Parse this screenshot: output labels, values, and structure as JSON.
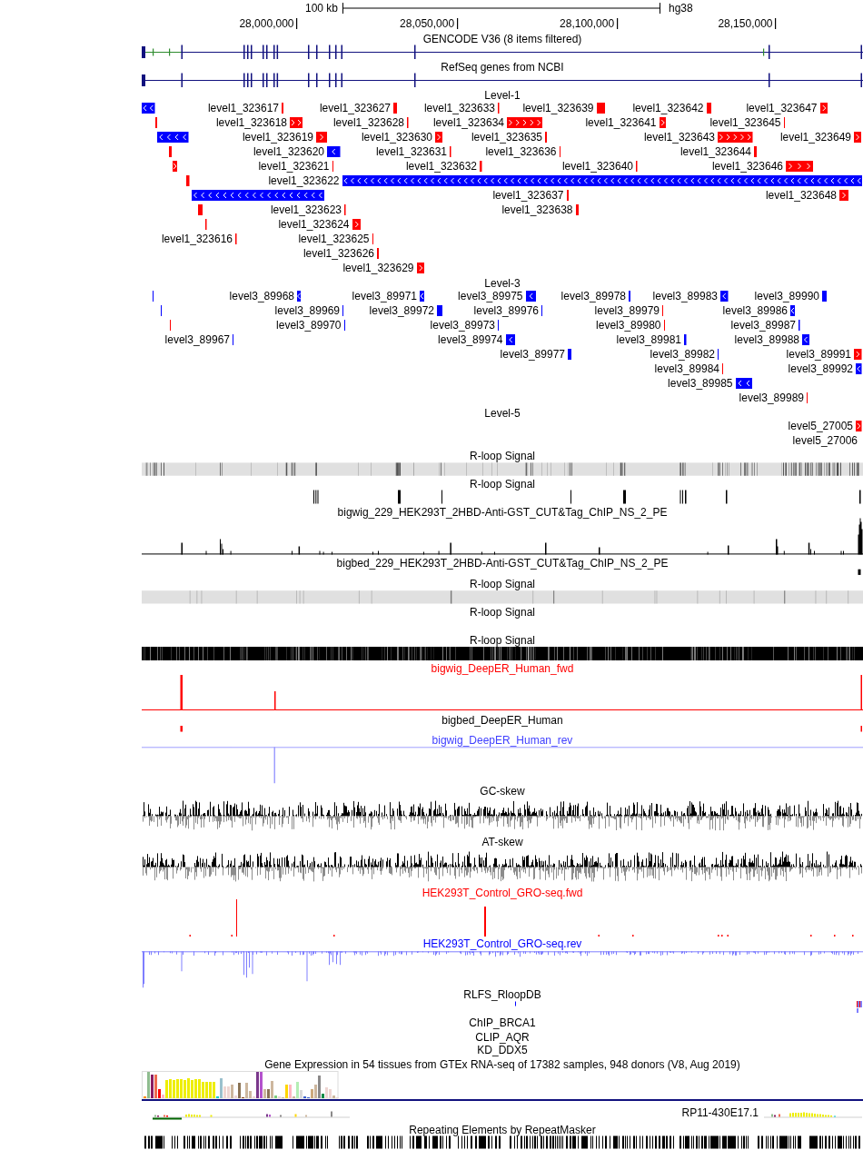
{
  "ruler": {
    "scale_label": "100 kb",
    "assembly": "hg38",
    "ticks": [
      "28,000,000",
      "28,050,000",
      "28,100,000",
      "28,150,000"
    ]
  },
  "tracks": [
    {
      "kind": "gene",
      "title": "GENCODE V36 (8 items filtered)",
      "color": "#000000"
    },
    {
      "kind": "gene",
      "title": "RefSeq genes from NCBI",
      "color": "#000000"
    },
    {
      "kind": "features",
      "title": "Level-1",
      "color": "#000000",
      "items": [
        {
          "kind": "minus"
        },
        {
          "label": "level1_323617",
          "kind": "plus"
        },
        {
          "label": "level1_323627",
          "kind": "plus"
        },
        {
          "label": "level1_323633",
          "kind": "plus"
        },
        {
          "label": "level1_323639",
          "kind": "plus"
        },
        {
          "label": "level1_323642",
          "kind": "plus"
        },
        {
          "label": "level1_323647",
          "kind": "plus"
        },
        {
          "kind": "plus"
        },
        {
          "label": "level1_323618",
          "kind": "plus"
        },
        {
          "label": "level1_323628",
          "kind": "plus"
        },
        {
          "label": "level1_323634",
          "kind": "plus"
        },
        {
          "label": "level1_323641",
          "kind": "plus"
        },
        {
          "label": "level1_323645",
          "kind": "plus"
        },
        {
          "kind": "minus"
        },
        {
          "label": "level1_323619",
          "kind": "plus"
        },
        {
          "label": "level1_323630",
          "kind": "plus"
        },
        {
          "label": "level1_323635",
          "kind": "plus"
        },
        {
          "label": "level1_323643",
          "kind": "plus"
        },
        {
          "label": "level1_323649",
          "kind": "plus"
        },
        {
          "kind": "plus"
        },
        {
          "label": "level1_323620",
          "kind": "minus"
        },
        {
          "label": "level1_323631",
          "kind": "plus"
        },
        {
          "label": "level1_323636",
          "kind": "plus"
        },
        {
          "label": "level1_323644",
          "kind": "plus"
        },
        {
          "kind": "plus"
        },
        {
          "label": "level1_323621",
          "kind": "plus"
        },
        {
          "label": "level1_323632",
          "kind": "plus"
        },
        {
          "label": "level1_323640",
          "kind": "plus"
        },
        {
          "label": "level1_323646",
          "kind": "plus"
        },
        {
          "kind": "plus"
        },
        {
          "label": "level1_323622",
          "kind": "minus"
        },
        {
          "kind": "minus"
        },
        {
          "label": "level1_323637",
          "kind": "plus"
        },
        {
          "label": "level1_323648",
          "kind": "plus"
        },
        {
          "kind": "plus"
        },
        {
          "label": "level1_323623",
          "kind": "plus"
        },
        {
          "label": "level1_323638",
          "kind": "plus"
        },
        {
          "kind": "plus"
        },
        {
          "label": "level1_323624",
          "kind": "plus"
        },
        {
          "label": "level1_323616",
          "kind": "plus"
        },
        {
          "label": "level1_323625",
          "kind": "plus"
        },
        {
          "label": "level1_323626",
          "kind": "plus"
        },
        {
          "label": "level1_323629",
          "kind": "plus"
        }
      ]
    },
    {
      "kind": "features",
      "title": "Level-3",
      "color": "#000000",
      "items": [
        {
          "kind": "minus"
        },
        {
          "label": "level3_89968",
          "kind": "minus"
        },
        {
          "label": "level3_89971",
          "kind": "minus"
        },
        {
          "label": "level3_89975",
          "kind": "minus"
        },
        {
          "label": "level3_89978",
          "kind": "minus"
        },
        {
          "label": "level3_89983",
          "kind": "minus"
        },
        {
          "label": "level3_89990",
          "kind": "minus"
        },
        {
          "kind": "minus"
        },
        {
          "label": "level3_89969",
          "kind": "minus"
        },
        {
          "label": "level3_89972",
          "kind": "minus"
        },
        {
          "label": "level3_89976",
          "kind": "minus"
        },
        {
          "label": "level3_89979",
          "kind": "plus"
        },
        {
          "label": "level3_89986",
          "kind": "minus"
        },
        {
          "kind": "plus"
        },
        {
          "label": "level3_89970",
          "kind": "minus"
        },
        {
          "label": "level3_89973",
          "kind": "minus"
        },
        {
          "label": "level3_89980",
          "kind": "plus"
        },
        {
          "label": "level3_89987",
          "kind": "minus"
        },
        {
          "label": "level3_89967",
          "kind": "minus"
        },
        {
          "label": "level3_89974",
          "kind": "minus"
        },
        {
          "label": "level3_89981",
          "kind": "minus"
        },
        {
          "label": "level3_89988",
          "kind": "minus"
        },
        {
          "label": "level3_89977",
          "kind": "minus"
        },
        {
          "label": "level3_89982",
          "kind": "minus"
        },
        {
          "label": "level3_89991",
          "kind": "plus"
        },
        {
          "label": "level3_89984",
          "kind": "plus"
        },
        {
          "label": "level3_89992",
          "kind": "minus"
        },
        {
          "label": "level3_89985",
          "kind": "minus"
        },
        {
          "label": "level3_89989",
          "kind": "plus"
        }
      ]
    },
    {
      "kind": "features",
      "title": "Level-5",
      "color": "#000000",
      "items": [
        {
          "label": "level5_27005",
          "kind": "plus"
        },
        {
          "label": "level5_27006",
          "kind": "label"
        }
      ]
    },
    {
      "kind": "heatmap",
      "title": "R-loop Signal",
      "color": "#000000"
    },
    {
      "kind": "marks",
      "title": "R-loop Signal",
      "color": "#000000"
    },
    {
      "kind": "wiggle",
      "title": "bigwig_229_HEK293T_2HBD-Anti-GST_CUT&Tag_ChIP_NS_2_PE",
      "color": "#000000"
    },
    {
      "kind": "marks",
      "title": "bigbed_229_HEK293T_2HBD-Anti-GST_CUT&Tag_ChIP_NS_2_PE",
      "color": "#000000"
    },
    {
      "kind": "heatmap",
      "title": "R-loop Signal",
      "color": "#000000"
    },
    {
      "kind": "empty",
      "title": "R-loop Signal",
      "color": "#000000"
    },
    {
      "kind": "heatmap",
      "title": "R-loop Signal",
      "color": "#000000"
    },
    {
      "kind": "wiggle",
      "title": "bigwig_DeepER_Human_fwd",
      "color": "#ff0000"
    },
    {
      "kind": "marks",
      "title": "bigbed_DeepER_Human",
      "color": "#000000"
    },
    {
      "kind": "wiggle",
      "title": "bigwig_DeepER_Human_rev",
      "color": "#4040ff"
    },
    {
      "kind": "skew",
      "title": "GC-skew",
      "color": "#000000"
    },
    {
      "kind": "skew",
      "title": "AT-skew",
      "color": "#000000"
    },
    {
      "kind": "wiggle",
      "title": "HEK293T_Control_GRO-seq.fwd",
      "color": "#ff0000"
    },
    {
      "kind": "wiggle",
      "title": "HEK293T_Control_GRO-seq.rev",
      "color": "#0000ff"
    },
    {
      "kind": "marks",
      "title": "RLFS_RloopDB",
      "color": "#000000"
    },
    {
      "kind": "empty",
      "title": "ChIP_BRCA1",
      "color": "#000000"
    },
    {
      "kind": "empty",
      "title": "CLIP_AQR",
      "color": "#000000"
    },
    {
      "kind": "empty",
      "title": "KD_DDX5",
      "color": "#000000"
    },
    {
      "kind": "expression",
      "title": "Gene Expression in 54 tissues from GTEx RNA-seq of 17382 samples, 948 donors (V8, Aug 2019)",
      "color": "#000000",
      "gene_label": "RP11-430E17.1"
    },
    {
      "kind": "repeats",
      "title": "Repeating Elements by RepeatMasker",
      "color": "#000000"
    }
  ]
}
